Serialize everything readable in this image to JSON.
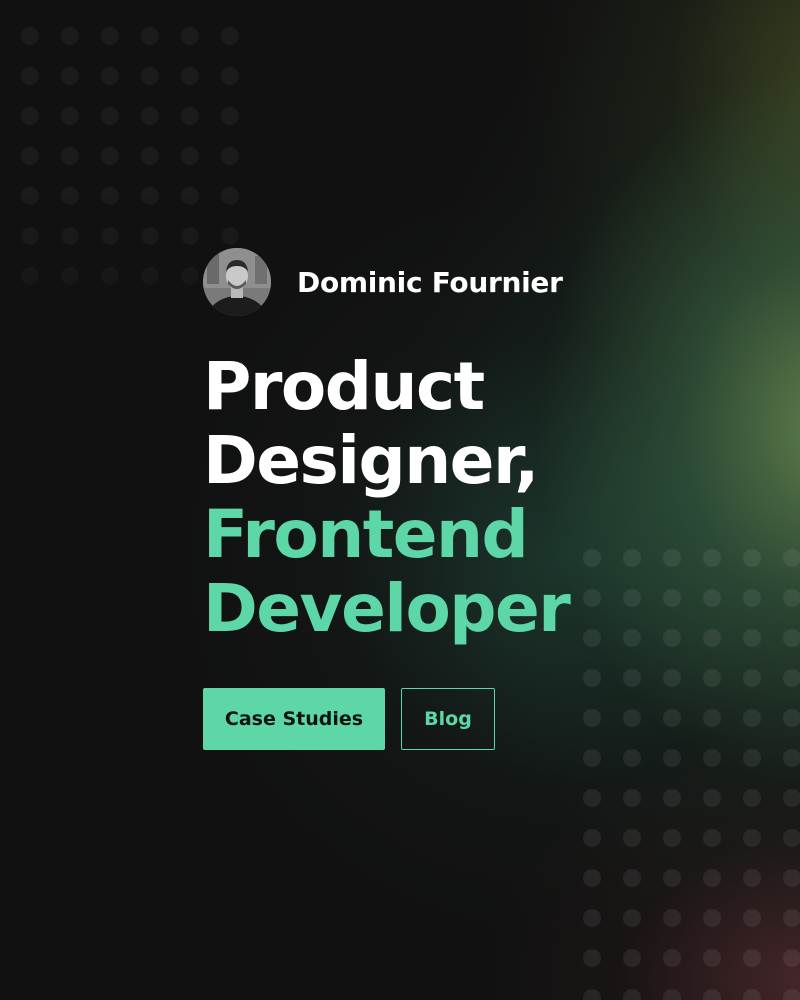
{
  "profile": {
    "name": "Dominic Fournier",
    "avatar_icon": "person-photo"
  },
  "headline": {
    "line1": "Product",
    "line2": "Designer,",
    "line3": "Frontend",
    "line4": "Developer"
  },
  "actions": {
    "primary_label": "Case Studies",
    "secondary_label": "Blog"
  },
  "colors": {
    "accent": "#5dd6a8",
    "background": "#111111",
    "text": "#ffffff"
  }
}
